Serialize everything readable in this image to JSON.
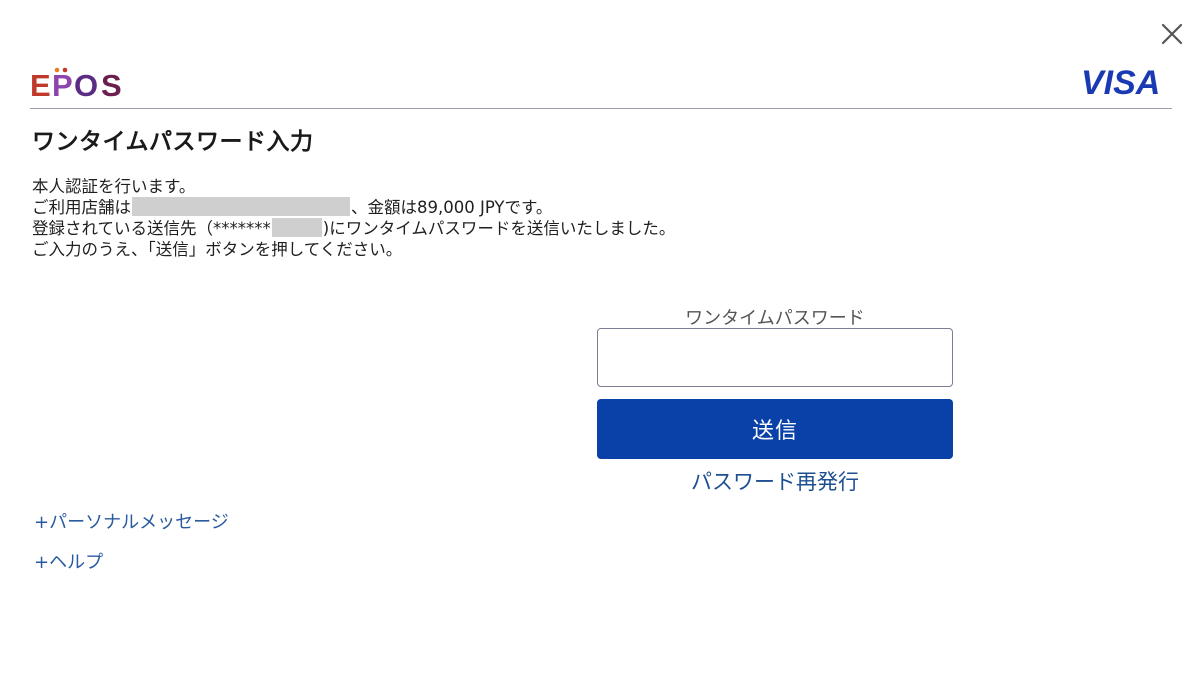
{
  "header": {
    "brand_logo": "EPOS",
    "network_logo": "VISA",
    "close_icon": "close-icon",
    "brand_colors": {
      "epos_e": "#c0392b",
      "epos_p": "#8e44ad",
      "epos_o": "#5b2c83",
      "epos_s": "#6c1f4f",
      "visa": "#1a3ab3"
    }
  },
  "page": {
    "title": "ワンタイムパスワード入力"
  },
  "message": {
    "line1": "本人認証を行います。",
    "line2_prefix": "ご利用店舗は",
    "line2_suffix": "、金額は89,000 JPYです。",
    "line3_prefix": "登録されている送信先（*******",
    "line3_suffix": ")にワンタイムパスワードを送信いたしました。",
    "line4": "ご入力のうえ、「送信」ボタンを押してください。"
  },
  "form": {
    "otp_label": "ワンタイムパスワード",
    "otp_value": "",
    "submit_label": "送信",
    "resend_label": "パスワード再発行"
  },
  "sections": {
    "personal_message": "+パーソナルメッセージ",
    "help": "+ヘルプ"
  },
  "colors": {
    "primary_button": "#0a41a8",
    "link": "#1d4f91",
    "divider": "#9c9cb6"
  }
}
